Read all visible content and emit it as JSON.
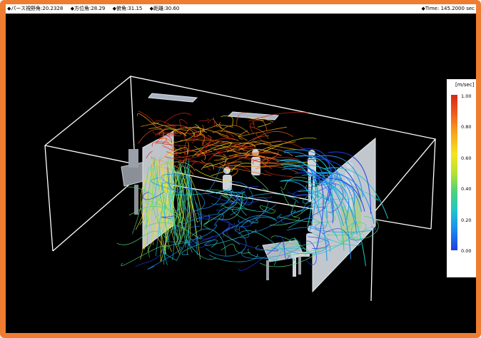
{
  "status_bar": {
    "items": [
      "◆パース視野角:20.2328",
      "◆方位角:28.29",
      "◆俯角:31.15",
      "◆距離:30.60"
    ],
    "time": "◆Time: 145.2000 sec"
  },
  "legend": {
    "unit": "[m/sec]",
    "ticks": [
      "1.00",
      "0.80",
      "0.60",
      "0.40",
      "0.20",
      "0.00"
    ],
    "colors": [
      "#d62818",
      "#f05a1c",
      "#f7a21a",
      "#f5e41e",
      "#b9e230",
      "#4fd17a",
      "#1fc7c9",
      "#1b8ff0",
      "#1f3ee0"
    ]
  },
  "colors": {
    "frame": "#ee7d32",
    "background": "#000000",
    "room_edges": "#ffffff",
    "partition": "#c8ccd2"
  }
}
